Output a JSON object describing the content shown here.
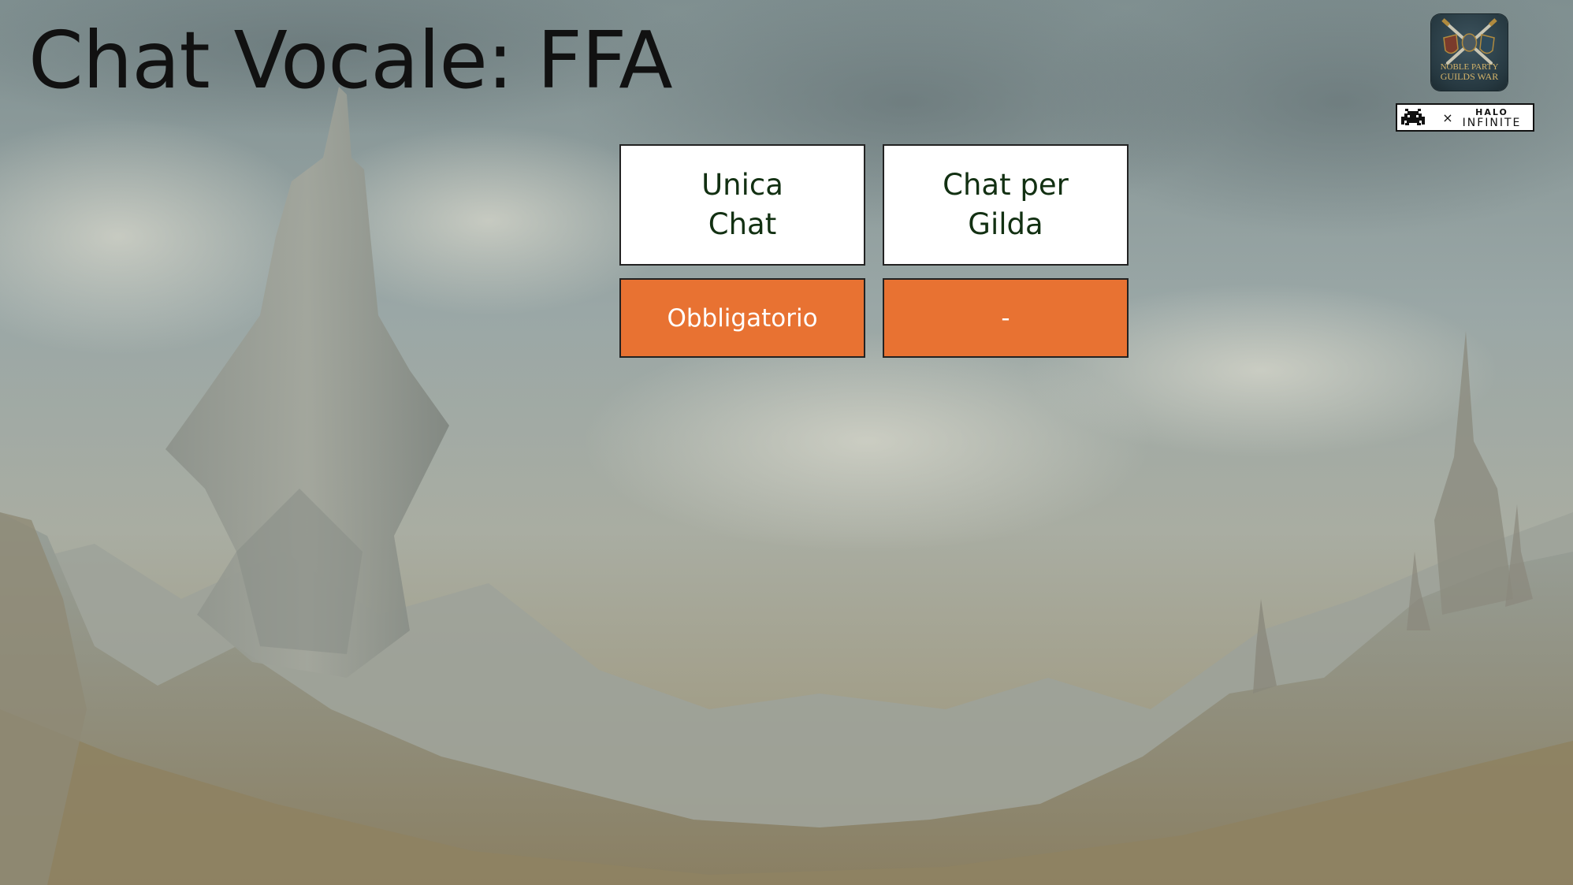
{
  "slide": {
    "title": "Chat Vocale: FFA"
  },
  "table": {
    "columns": [
      {
        "header_line1": "Unica",
        "header_line2": "Chat",
        "value": "Obbligatorio"
      },
      {
        "header_line1": "Chat per",
        "header_line2": "Gilda",
        "value": "-"
      }
    ]
  },
  "logos": {
    "badge_icon": "noble-party-guilds-war-logo",
    "badge_text_line1": "NOBLE PARTY",
    "badge_text_line2": "GUILDS WAR",
    "sponsor_icon": "space-invader-icon",
    "sponsor_separator": "×",
    "sponsor_top": "HALO",
    "sponsor_bottom": "INFINITE"
  },
  "colors": {
    "accent_orange": "#e87232",
    "header_text": "#123012",
    "title_text": "#111111"
  }
}
